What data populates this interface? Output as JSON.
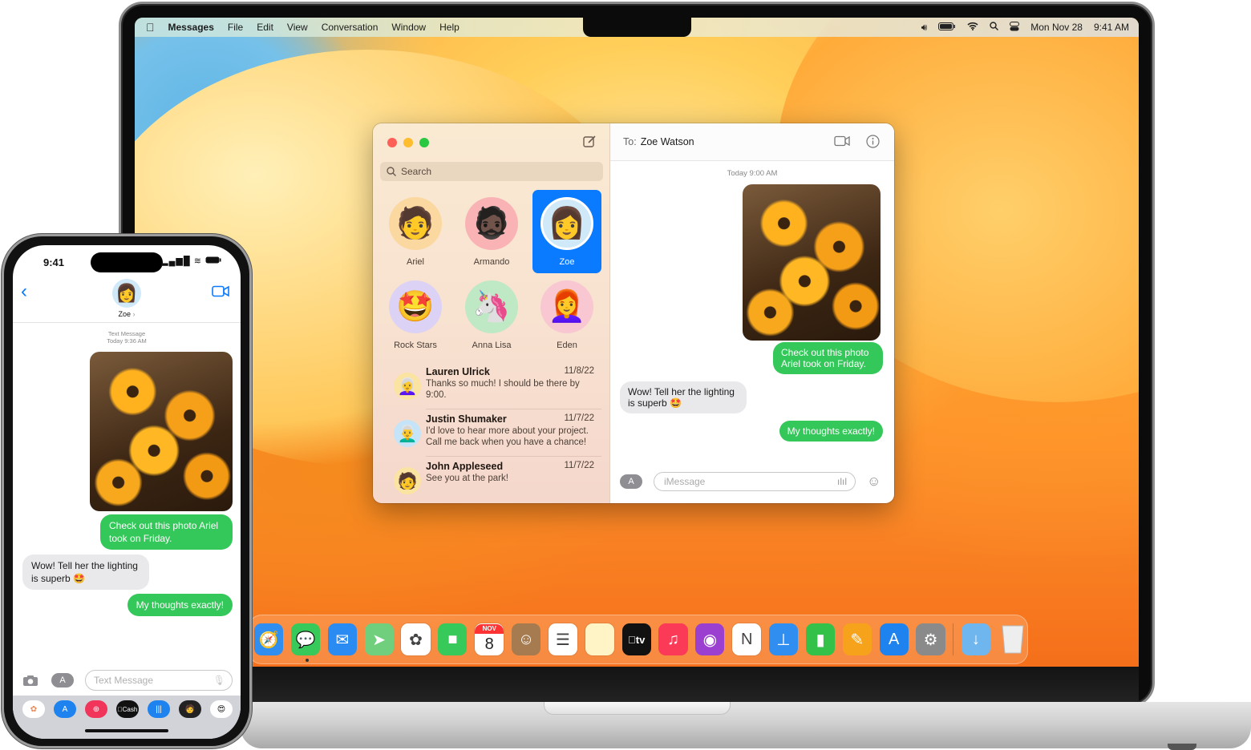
{
  "mac": {
    "menubar": {
      "apple_icon": "apple-logo-icon",
      "app_name": "Messages",
      "items": [
        "File",
        "Edit",
        "View",
        "Conversation",
        "Window",
        "Help"
      ],
      "status_icons": [
        "volume-icon",
        "battery-icon",
        "wifi-icon",
        "search-icon",
        "control-center-icon"
      ],
      "date": "Mon Nov 28",
      "time": "9:41 AM"
    },
    "messages_window": {
      "search_placeholder": "Search",
      "pinned": [
        {
          "name": "Ariel",
          "avatar": "memoji-ariel",
          "emoji": "🧑",
          "bg": "#fbd8a0",
          "selected": false
        },
        {
          "name": "Armando",
          "avatar": "memoji-armando",
          "emoji": "🧔🏿",
          "bg": "#f9b3b5",
          "selected": false
        },
        {
          "name": "Zoe",
          "avatar": "memoji-zoe",
          "emoji": "👩",
          "bg": "#cfe9f8",
          "selected": true
        },
        {
          "name": "Rock Stars",
          "avatar": "star-struck-emoji",
          "emoji": "🤩",
          "bg": "#dcd2f5",
          "selected": false
        },
        {
          "name": "Anna Lisa",
          "avatar": "unicorn-memoji",
          "emoji": "🦄",
          "bg": "#bfe8c5",
          "selected": false
        },
        {
          "name": "Eden",
          "avatar": "memoji-eden",
          "emoji": "👩‍🦰",
          "bg": "#f8c7d2",
          "selected": false
        }
      ],
      "conversations": [
        {
          "name": "Lauren Ulrick",
          "date": "11/8/22",
          "preview": "Thanks so much! I should be there by 9:00.",
          "emoji": "👩‍🦳",
          "bg": "#fbe3a2"
        },
        {
          "name": "Justin Shumaker",
          "date": "11/7/22",
          "preview": "I'd love to hear more about your project. Call me back when you have a chance!",
          "emoji": "👨‍🦳",
          "bg": "#c6e4f7"
        },
        {
          "name": "John Appleseed",
          "date": "11/7/22",
          "preview": "See you at the park!",
          "emoji": "🧑",
          "bg": "#fbe3a2"
        }
      ],
      "chat": {
        "to_label": "To:",
        "to_name": "Zoe Watson",
        "timestamp": "Today 9:00 AM",
        "photo": "sunflowers-photo",
        "messages": [
          {
            "direction": "out",
            "text": "Check out this photo Ariel took on Friday."
          },
          {
            "direction": "in",
            "text": "Wow! Tell her the lighting is superb 🤩"
          },
          {
            "direction": "out",
            "text": "My thoughts exactly!"
          }
        ],
        "input_placeholder": "iMessage"
      }
    },
    "dock": [
      {
        "name": "Safari",
        "icon": "safari-icon",
        "glyph": "🧭",
        "bg": "#2f8ef0"
      },
      {
        "name": "Messages",
        "icon": "messages-icon",
        "glyph": "💬",
        "bg": "#37c95a",
        "running": true
      },
      {
        "name": "Mail",
        "icon": "mail-icon",
        "glyph": "✉",
        "bg": "#2a8bf2"
      },
      {
        "name": "Maps",
        "icon": "maps-icon",
        "glyph": "➤",
        "bg": "#6fcf7c"
      },
      {
        "name": "Photos",
        "icon": "photos-icon",
        "glyph": "✿",
        "bg": "#ffffff"
      },
      {
        "name": "FaceTime",
        "icon": "facetime-icon",
        "glyph": "■",
        "bg": "#37c95a"
      },
      {
        "name": "Calendar",
        "icon": "calendar-icon",
        "glyph": "8",
        "month": "NOV",
        "bg": "#ffffff"
      },
      {
        "name": "Contacts",
        "icon": "contacts-icon",
        "glyph": "☺",
        "bg": "#a57b4f"
      },
      {
        "name": "Reminders",
        "icon": "reminders-icon",
        "glyph": "☰",
        "bg": "#ffffff"
      },
      {
        "name": "Notes",
        "icon": "notes-icon",
        "glyph": "",
        "bg": "#fff4c6"
      },
      {
        "name": "TV",
        "icon": "apple-tv-icon",
        "glyph": "tv",
        "bg": "#111111"
      },
      {
        "name": "Music",
        "icon": "music-icon",
        "glyph": "♫",
        "bg": "#fa3a56"
      },
      {
        "name": "Podcasts",
        "icon": "podcasts-icon",
        "glyph": "◉",
        "bg": "#9b3fd1"
      },
      {
        "name": "News",
        "icon": "news-icon",
        "glyph": "N",
        "bg": "#ffffff"
      },
      {
        "name": "Keynote",
        "icon": "keynote-icon",
        "glyph": "⊥",
        "bg": "#2f8ef0"
      },
      {
        "name": "Numbers",
        "icon": "numbers-icon",
        "glyph": "▮",
        "bg": "#33c14a"
      },
      {
        "name": "Pages",
        "icon": "pages-icon",
        "glyph": "✎",
        "bg": "#f7a21b"
      },
      {
        "name": "App Store",
        "icon": "app-store-icon",
        "glyph": "A",
        "bg": "#1e83ef"
      },
      {
        "name": "System Settings",
        "icon": "system-settings-icon",
        "glyph": "⚙",
        "bg": "#8a8a8a"
      },
      {
        "name": "Downloads",
        "icon": "downloads-folder-icon",
        "glyph": "↓",
        "bg": "#6fb6ee"
      },
      {
        "name": "Trash",
        "icon": "trash-icon",
        "glyph": "",
        "bg": "#e8e8e8"
      }
    ]
  },
  "iphone": {
    "status_time": "9:41",
    "status_icons": [
      "signal-icon",
      "wifi-icon",
      "battery-icon"
    ],
    "contact_name": "Zoe",
    "chevron": "›",
    "thread_label": "Text Message",
    "timestamp": "Today 9:36 AM",
    "messages": [
      {
        "direction": "out",
        "text": "Check out this photo Ariel took on Friday."
      },
      {
        "direction": "in",
        "text": "Wow! Tell her the lighting is superb 🤩"
      },
      {
        "direction": "out",
        "text": "My thoughts exactly!"
      }
    ],
    "input_placeholder": "Text Message",
    "app_tray": [
      {
        "name": "Photos",
        "icon": "photos-icon",
        "glyph": "✿",
        "bg": "#ffffff",
        "fg": "#e85"
      },
      {
        "name": "App Store",
        "icon": "app-store-icon",
        "glyph": "A",
        "bg": "#1e83ef",
        "fg": "#fff"
      },
      {
        "name": "Images",
        "icon": "image-search-icon",
        "glyph": "⊕",
        "bg": "#f0345a",
        "fg": "#fff"
      },
      {
        "name": "Apple Cash",
        "icon": "apple-cash-icon",
        "glyph": "Cash",
        "bg": "#111111",
        "fg": "#fff"
      },
      {
        "name": "Audio",
        "icon": "audio-message-icon",
        "glyph": "|||",
        "bg": "#1e83ef",
        "fg": "#fff"
      },
      {
        "name": "Memoji",
        "icon": "memoji-icon",
        "glyph": "🧑",
        "bg": "#222222",
        "fg": "#fff"
      },
      {
        "name": "Memoji Stickers",
        "icon": "memoji-stickers-icon",
        "glyph": "😍",
        "bg": "#ffffff",
        "fg": "#000"
      }
    ]
  }
}
